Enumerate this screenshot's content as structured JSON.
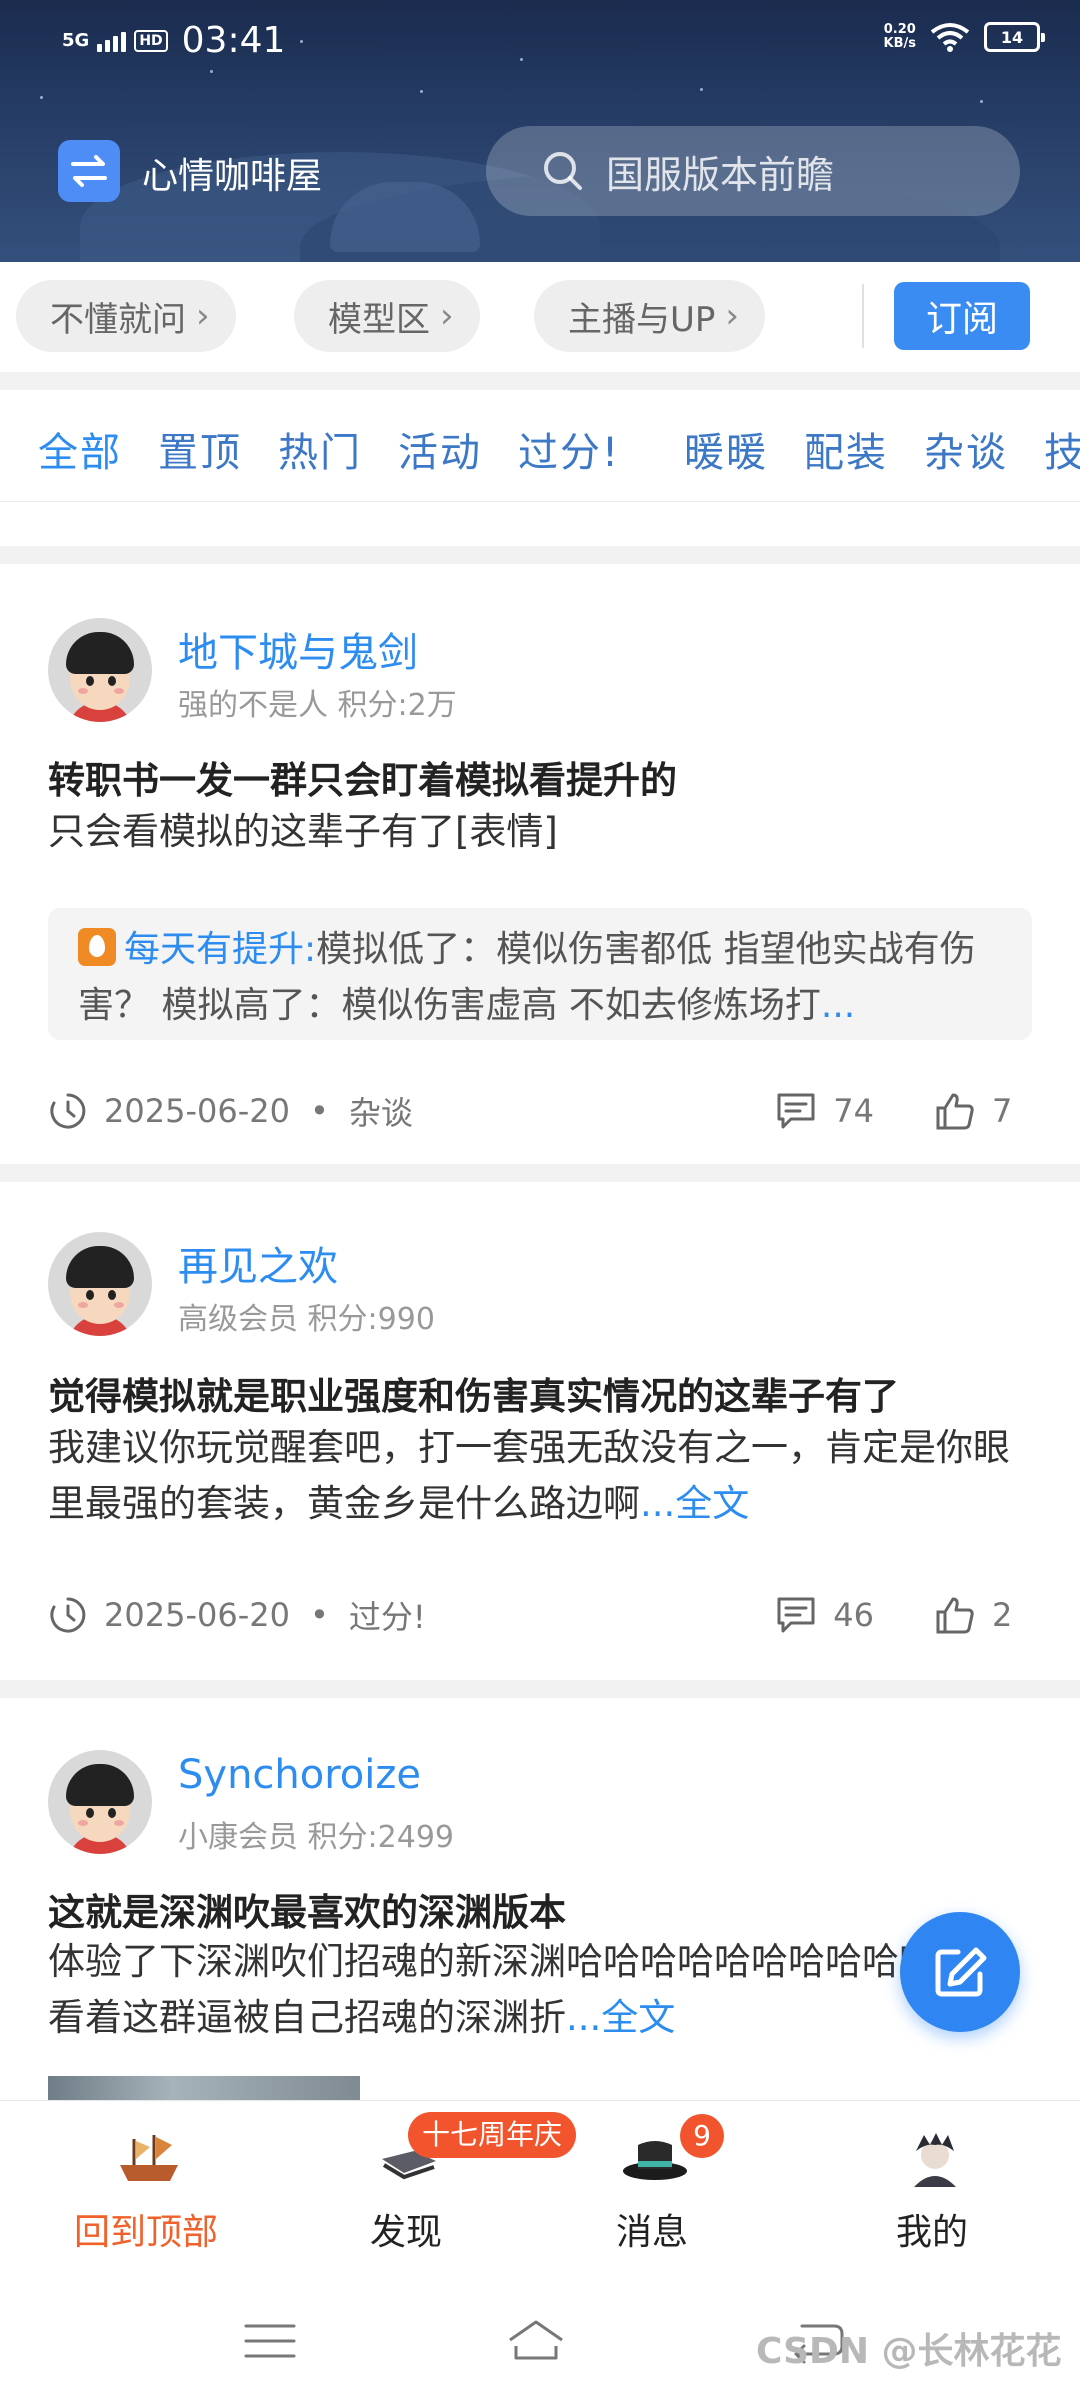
{
  "status_bar": {
    "network": "5G",
    "hd_label": "HD",
    "time": "03:41",
    "speed_value": "0.20",
    "speed_unit": "KB/s",
    "battery": "14"
  },
  "header": {
    "app_title": "心情咖啡屋",
    "search_placeholder": "国服版本前瞻"
  },
  "chips": [
    {
      "label": "不懂就问"
    },
    {
      "label": "模型区"
    },
    {
      "label": "主播与UP"
    }
  ],
  "subscribe_label": "订阅",
  "tabs": [
    {
      "label": "全部",
      "active": true
    },
    {
      "label": "置顶"
    },
    {
      "label": "热门"
    },
    {
      "label": "活动"
    },
    {
      "label": "过分!"
    },
    {
      "label": "暖暖"
    },
    {
      "label": "配装"
    },
    {
      "label": "杂谈"
    },
    {
      "label": "技"
    }
  ],
  "posts": [
    {
      "username": "地下城与鬼剑",
      "user_rank": "强的不是人",
      "user_points": "积分:2万",
      "title": "转职书一发一群只会盯着模拟看提升的",
      "body": "只会看模拟的这辈子有了[表情]",
      "quote": {
        "name": "每天有提升:",
        "text": "模拟低了：模似伤害都低  指望他实战有伤害？ 模拟高了：模似伤害虚高  不如去修炼场打",
        "more": "..."
      },
      "date": "2025-06-20",
      "category": "杂谈",
      "comments": "74",
      "likes": "7"
    },
    {
      "username": "再见之欢",
      "user_rank": "高级会员",
      "user_points": "积分:990",
      "title": "觉得模拟就是职业强度和伤害真实情况的这辈子有了",
      "body": "我建议你玩觉醒套吧，打一套强无敌没有之一，肯定是你眼里最强的套装，黄金乡是什么路边啊",
      "more": "...全文",
      "date": "2025-06-20",
      "category": "过分!",
      "comments": "46",
      "likes": "2"
    },
    {
      "username": "Synchoroize",
      "user_rank": "小康会员",
      "user_points": "积分:2499",
      "title": "这就是深渊吹最喜欢的深渊版本",
      "body": "体验了下深渊吹们招魂的新深渊哈哈哈哈哈哈哈哈哈哈哈哈看着这群逼被自己招魂的深渊折",
      "more": "...全文"
    }
  ],
  "bottom_nav": [
    {
      "label": "回到顶部",
      "active": true
    },
    {
      "label": "发现"
    },
    {
      "label": "消息"
    },
    {
      "label": "我的"
    }
  ],
  "event_badge": "十七周年庆",
  "message_count": "9",
  "watermark": "CSDN @长林花花",
  "colors": {
    "accent": "#2d8cf0",
    "active_nav": "#f0612b",
    "badge": "#f2552d",
    "fab": "#2f86f2"
  }
}
